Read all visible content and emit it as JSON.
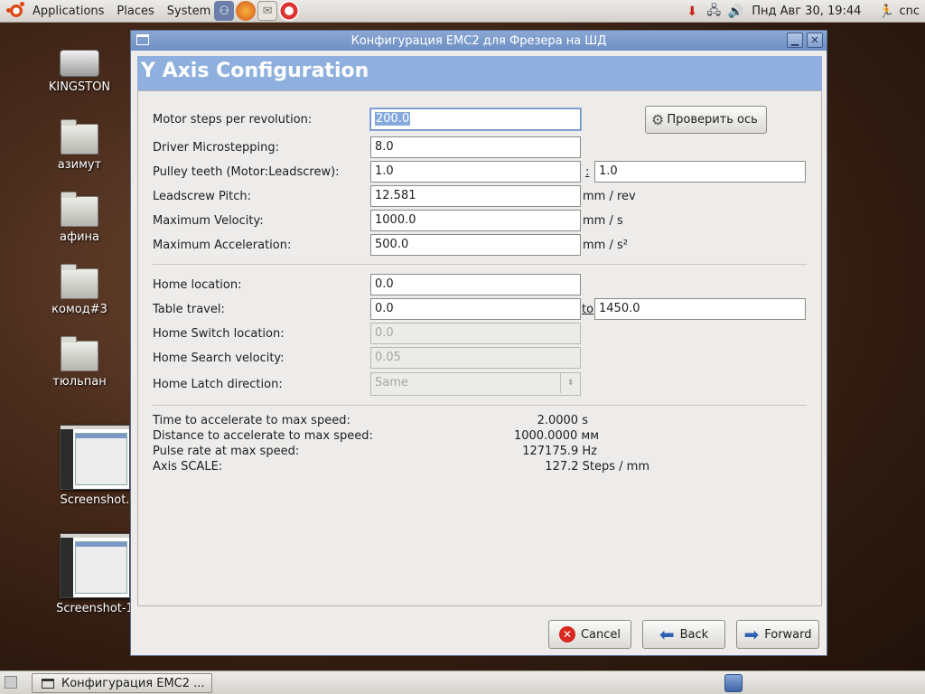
{
  "top_panel": {
    "menus": [
      "Applications",
      "Places",
      "System"
    ],
    "clock": "Пнд Авг 30, 19:44",
    "user": "cnc"
  },
  "desktop": {
    "icons": [
      {
        "label": "KINGSTON",
        "kind": "drive-icon"
      },
      {
        "label": "азимут",
        "kind": "folder-icon"
      },
      {
        "label": "афина",
        "kind": "folder-icon"
      },
      {
        "label": "комод#3",
        "kind": "folder-icon"
      },
      {
        "label": "тюльпан",
        "kind": "folder-icon"
      },
      {
        "label": "Screenshot.",
        "kind": "screenshot-thumbnail"
      },
      {
        "label": "Screenshot-1",
        "kind": "screenshot-thumbnail"
      }
    ]
  },
  "window": {
    "title": "Конфигурация EMC2 для Фрезера на ШД",
    "section_title": "Y Axis Configuration",
    "test_button": "Проверить ось",
    "fields": {
      "motor_steps": {
        "label": "Motor steps per revolution:",
        "value": "200.0"
      },
      "microstepping": {
        "label": "Driver Microstepping:",
        "value": "8.0"
      },
      "pulley": {
        "label": "Pulley teeth (Motor:Leadscrew):",
        "value1": "1.0",
        "sep": ":",
        "value2": "1.0"
      },
      "leadscrew": {
        "label": "Leadscrew Pitch:",
        "value": "12.581",
        "unit": "mm / rev"
      },
      "max_velocity": {
        "label": "Maximum Velocity:",
        "value": "1000.0",
        "unit": "mm / s"
      },
      "max_accel": {
        "label": "Maximum Acceleration:",
        "value": "500.0",
        "unit": "mm / s²"
      },
      "home_location": {
        "label": "Home location:",
        "value": "0.0"
      },
      "table_travel": {
        "label": "Table travel:",
        "value1": "0.0",
        "to": "to",
        "value2": "1450.0"
      },
      "home_switch": {
        "label": "Home Switch location:",
        "value": "0.0"
      },
      "home_search": {
        "label": "Home Search velocity:",
        "value": "0.05"
      },
      "home_latch": {
        "label": "Home Latch direction:",
        "value": "Same"
      }
    },
    "stats": [
      {
        "label": "Time to accelerate to max speed:",
        "value": "2.0000 s"
      },
      {
        "label": "Distance to accelerate to max speed:",
        "value": "1000.0000 мм"
      },
      {
        "label": "Pulse rate at max speed:",
        "value": "127175.9 Hz"
      },
      {
        "label": "Axis SCALE:",
        "value": "127.2 Steps / mm"
      }
    ],
    "buttons": {
      "cancel": "Cancel",
      "back": "Back",
      "forward": "Forward"
    }
  },
  "taskbar": {
    "task_label": "Конфигурация EMC2 ..."
  },
  "colors": {
    "titlebar": "#7b9acb",
    "section_banner": "#8fb0de",
    "cancel_red": "#d8281f",
    "arrow_blue": "#2f62b5"
  }
}
